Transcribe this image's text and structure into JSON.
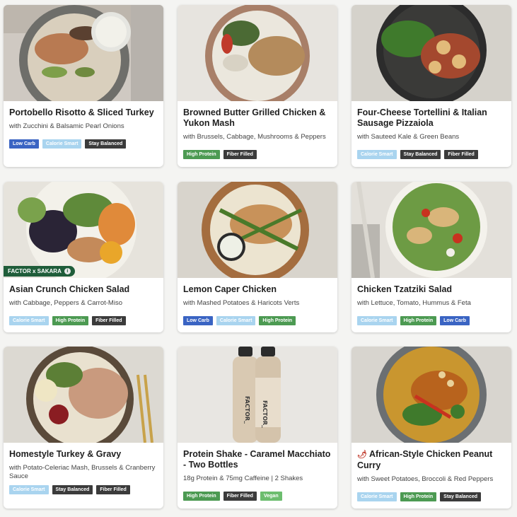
{
  "badge_labels": {
    "low_carb": "Low Carb",
    "calorie_smart": "Calorie Smart",
    "stay_balanced": "Stay Balanced",
    "high_protein": "High Protein",
    "fiber_filled": "Fiber Filled",
    "vegan": "Vegan"
  },
  "colors": {
    "low_carb": "#3a64c3",
    "calorie_smart": "#a9d4ef",
    "stay_balanced": "#3b3b3b",
    "high_protein": "#4c9a52",
    "fiber_filled": "#3b3b3b",
    "vegan": "#6cbd6e",
    "partner_tag": "#1f5d3a"
  },
  "meals": [
    {
      "title": "Portobello Risotto & Sliced Turkey",
      "subtitle": "with Zucchini & Balsamic Pearl Onions",
      "badges": [
        "Low Carb",
        "Calorie Smart",
        "Stay Balanced"
      ]
    },
    {
      "title": "Browned Butter Grilled Chicken & Yukon Mash",
      "subtitle": "with Brussels, Cabbage, Mushrooms & Peppers",
      "badges": [
        "High Protein",
        "Fiber Filled"
      ]
    },
    {
      "title": "Four-Cheese Tortellini & Italian Sausage Pizzaiola",
      "subtitle": "with Sauteed Kale & Green Beans",
      "badges": [
        "Calorie Smart",
        "Stay Balanced",
        "Fiber Filled"
      ]
    },
    {
      "title": "Asian Crunch Chicken Salad",
      "subtitle": "with Cabbage, Peppers & Carrot-Miso",
      "badges": [
        "Calorie Smart",
        "High Protein",
        "Fiber Filled"
      ],
      "partner_tag": "FACTOR x SAKARA",
      "partner_icon": "info-icon"
    },
    {
      "title": "Lemon Caper Chicken",
      "subtitle": "with Mashed Potatoes & Haricots Verts",
      "badges": [
        "Low Carb",
        "Calorie Smart",
        "High Protein"
      ]
    },
    {
      "title": "Chicken Tzatziki Salad",
      "subtitle": "with Lettuce, Tomato, Hummus & Feta",
      "badges": [
        "Calorie Smart",
        "High Protein",
        "Low Carb"
      ]
    },
    {
      "title": "Homestyle Turkey & Gravy",
      "subtitle": "with Potato-Celeriac Mash, Brussels & Cranberry Sauce",
      "badges": [
        "Calorie Smart",
        "Stay Balanced",
        "Fiber Filled"
      ]
    },
    {
      "title": "Protein Shake - Caramel Macchiato - Two Bottles",
      "subtitle": "18g Protein & 75mg Caffeine | 2 Shakes",
      "badges": [
        "High Protein",
        "Fiber Filled",
        "Vegan"
      ],
      "bottle_label": "FACTOR_"
    },
    {
      "title": "African-Style Chicken Peanut Curry",
      "title_icon": "chili-pepper-icon",
      "subtitle": "with Sweet Potatoes, Broccoli & Red Peppers",
      "badges": [
        "Calorie Smart",
        "High Protein",
        "Stay Balanced"
      ]
    }
  ]
}
